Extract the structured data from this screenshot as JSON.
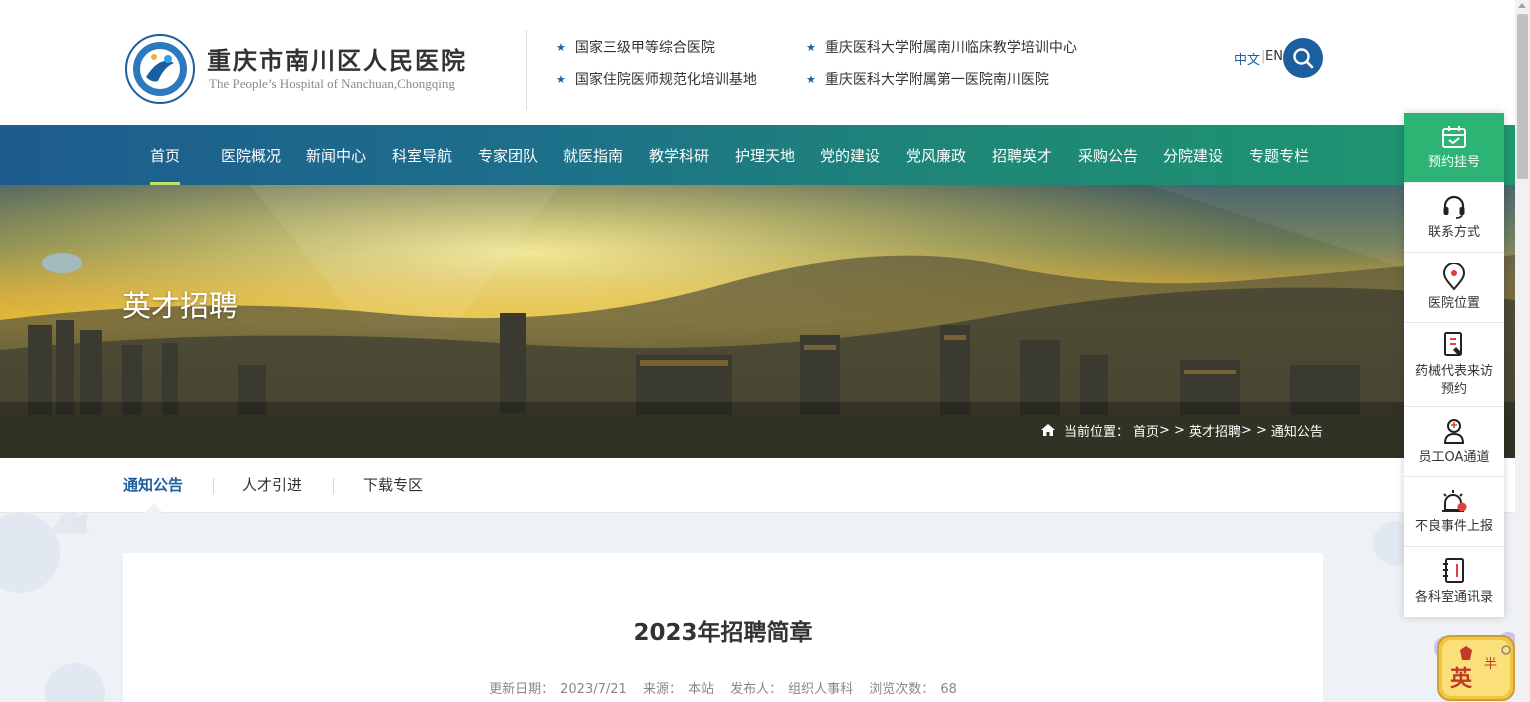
{
  "header": {
    "logo_cn": "重庆市南川区人民医院",
    "logo_en": "The People’s Hospital of Nanchuan,Chongqing",
    "credentials": [
      "国家三级甲等综合医院",
      "重庆医科大学附属南川临床教学培训中心",
      "国家住院医师规范化培训基地",
      "重庆医科大学附属第一医院南川医院"
    ],
    "lang_cn": "中文",
    "lang_sep": "|",
    "lang_en": "EN",
    "search_icon": "search-icon"
  },
  "nav": {
    "items": [
      "首页",
      "医院概况",
      "新闻中心",
      "科室导航",
      "专家团队",
      "就医指南",
      "教学科研",
      "护理天地",
      "党的建设",
      "党风廉政",
      "招聘英才",
      "采购公告",
      "分院建设",
      "专题专栏"
    ],
    "active_index": 0,
    "active_color": "#b9e36a"
  },
  "banner": {
    "title": "英才招聘",
    "breadcrumb_label": "当前位置：",
    "breadcrumb": [
      "首页",
      "> >",
      "英才招聘",
      "> >",
      "通知公告"
    ]
  },
  "subnav": {
    "tabs": [
      "通知公告",
      "人才引进",
      "下载专区"
    ],
    "active_index": 0
  },
  "article": {
    "title": "2023年招聘简章",
    "meta": {
      "date_label": "更新日期：",
      "date": "2023/7/21",
      "source_label": "来源：",
      "source": "本站",
      "publisher_label": "发布人：",
      "publisher": "组织人事科",
      "views_label": "浏览次数：",
      "views": "68"
    }
  },
  "sidebar": {
    "items": [
      {
        "label": "预约挂号",
        "icon": "calendar-icon"
      },
      {
        "label": "联系方式",
        "icon": "headset-icon"
      },
      {
        "label": "医院位置",
        "icon": "location-pin-icon"
      },
      {
        "label": "药械代表来访预约",
        "icon": "document-icon"
      },
      {
        "label": "员工OA通道",
        "icon": "staff-icon"
      },
      {
        "label": "不良事件上报",
        "icon": "alarm-icon"
      },
      {
        "label": "各科室通讯录",
        "icon": "phonebook-icon"
      }
    ],
    "highlight_color": "#2bb473"
  },
  "ime": {
    "char_main": "英",
    "char_half": "半"
  },
  "colors": {
    "brand_blue": "#1b5f9e",
    "nav_start": "#1d5c8e",
    "nav_end": "#1f9670",
    "content_bg": "#eef1f5"
  }
}
